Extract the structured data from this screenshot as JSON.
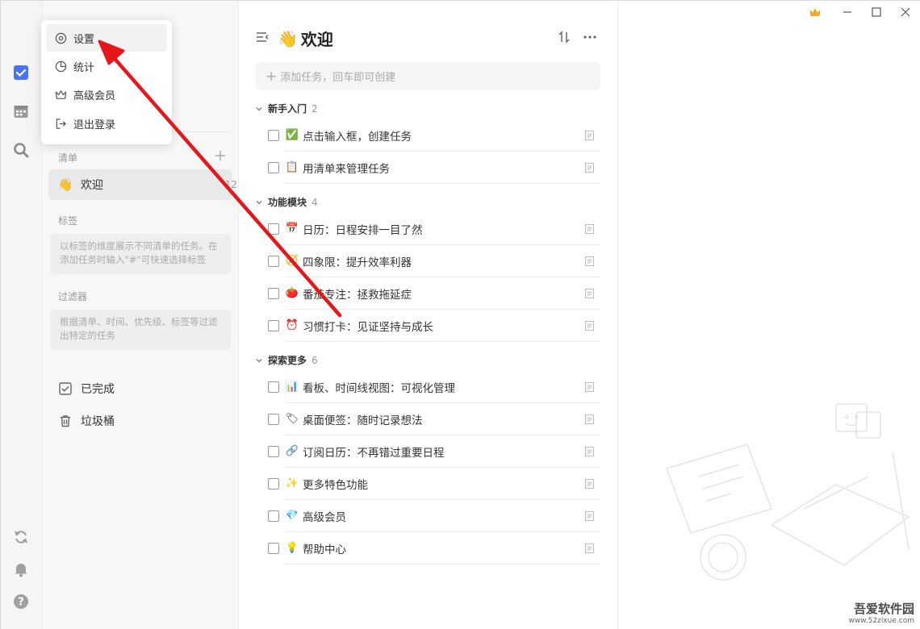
{
  "popup": {
    "items": [
      {
        "label": "设置",
        "icon": "settings-gear-icon"
      },
      {
        "label": "统计",
        "icon": "pie-chart-icon"
      },
      {
        "label": "高级会员",
        "icon": "crown-icon"
      },
      {
        "label": "退出登录",
        "icon": "logout-icon"
      }
    ]
  },
  "sidebar": {
    "lists_header": "清单",
    "welcome_item": {
      "label": "欢迎",
      "count": "12"
    },
    "tags_header": "标签",
    "tags_hint": "以标签的维度展示不同清单的任务。在添加任务时输入\"#\"可快速选择标签",
    "filters_header": "过滤器",
    "filters_hint": "根据清单、时间、优先级、标签等过滤出特定的任务",
    "completed": "已完成",
    "trash": "垃圾桶"
  },
  "main": {
    "title": "欢迎",
    "title_emoji": "👋",
    "add_placeholder": "添加任务，回车即可创建",
    "groups": [
      {
        "name": "新手入门",
        "count": "2",
        "tasks": [
          {
            "emoji": "✅",
            "text": "点击输入框，创建任务"
          },
          {
            "emoji": "📋",
            "text": "用清单来管理任务"
          }
        ]
      },
      {
        "name": "功能模块",
        "count": "4",
        "tasks": [
          {
            "emoji": "📅",
            "text": "日历：日程安排一目了然"
          },
          {
            "emoji": "🧭",
            "text": "四象限：提升效率利器"
          },
          {
            "emoji": "🍅",
            "text": "番茄专注：拯救拖延症"
          },
          {
            "emoji": "⏰",
            "text": "习惯打卡：见证坚持与成长"
          }
        ]
      },
      {
        "name": "探索更多",
        "count": "6",
        "tasks": [
          {
            "emoji": "📊",
            "text": "看板、时间线视图：可视化管理"
          },
          {
            "emoji": "🏷",
            "text": "桌面便签：随时记录想法"
          },
          {
            "emoji": "🔗",
            "text": "订阅日历：不再错过重要日程"
          },
          {
            "emoji": "✨",
            "text": "更多特色功能"
          },
          {
            "emoji": "💎",
            "text": "高级会员"
          },
          {
            "emoji": "💡",
            "text": "帮助中心"
          }
        ]
      }
    ]
  },
  "watermark": {
    "line1": "吾爱软件园",
    "line2": "www.52zixue.com"
  },
  "colors": {
    "accent": "#4772fa",
    "arrow": "#e8151b",
    "crown": "#f5a623"
  }
}
